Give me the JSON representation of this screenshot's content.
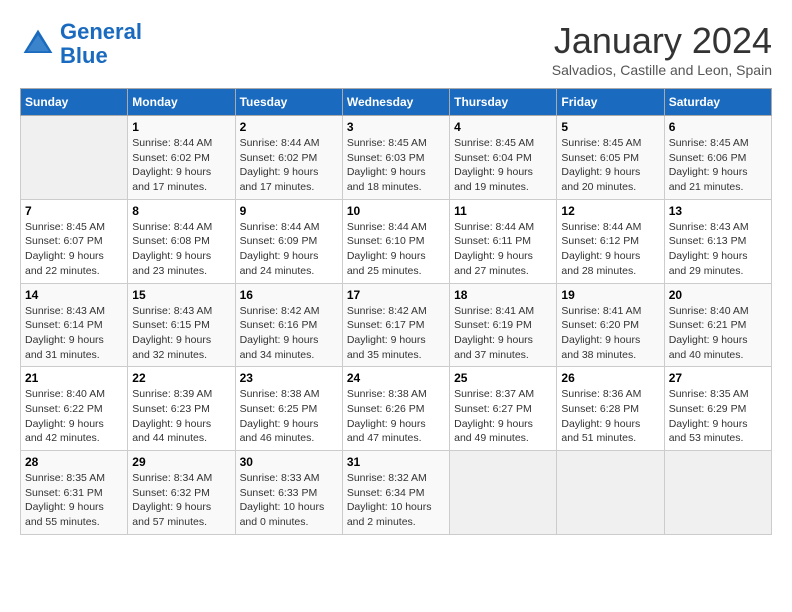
{
  "header": {
    "logo_line1": "General",
    "logo_line2": "Blue",
    "month_title": "January 2024",
    "subtitle": "Salvadios, Castille and Leon, Spain"
  },
  "weekdays": [
    "Sunday",
    "Monday",
    "Tuesday",
    "Wednesday",
    "Thursday",
    "Friday",
    "Saturday"
  ],
  "weeks": [
    [
      {
        "day": "",
        "empty": true
      },
      {
        "day": "1",
        "sunrise": "Sunrise: 8:44 AM",
        "sunset": "Sunset: 6:02 PM",
        "daylight": "Daylight: 9 hours and 17 minutes."
      },
      {
        "day": "2",
        "sunrise": "Sunrise: 8:44 AM",
        "sunset": "Sunset: 6:02 PM",
        "daylight": "Daylight: 9 hours and 17 minutes."
      },
      {
        "day": "3",
        "sunrise": "Sunrise: 8:45 AM",
        "sunset": "Sunset: 6:03 PM",
        "daylight": "Daylight: 9 hours and 18 minutes."
      },
      {
        "day": "4",
        "sunrise": "Sunrise: 8:45 AM",
        "sunset": "Sunset: 6:04 PM",
        "daylight": "Daylight: 9 hours and 19 minutes."
      },
      {
        "day": "5",
        "sunrise": "Sunrise: 8:45 AM",
        "sunset": "Sunset: 6:05 PM",
        "daylight": "Daylight: 9 hours and 20 minutes."
      },
      {
        "day": "6",
        "sunrise": "Sunrise: 8:45 AM",
        "sunset": "Sunset: 6:06 PM",
        "daylight": "Daylight: 9 hours and 21 minutes."
      }
    ],
    [
      {
        "day": "7",
        "sunrise": "Sunrise: 8:45 AM",
        "sunset": "Sunset: 6:07 PM",
        "daylight": "Daylight: 9 hours and 22 minutes."
      },
      {
        "day": "8",
        "sunrise": "Sunrise: 8:44 AM",
        "sunset": "Sunset: 6:08 PM",
        "daylight": "Daylight: 9 hours and 23 minutes."
      },
      {
        "day": "9",
        "sunrise": "Sunrise: 8:44 AM",
        "sunset": "Sunset: 6:09 PM",
        "daylight": "Daylight: 9 hours and 24 minutes."
      },
      {
        "day": "10",
        "sunrise": "Sunrise: 8:44 AM",
        "sunset": "Sunset: 6:10 PM",
        "daylight": "Daylight: 9 hours and 25 minutes."
      },
      {
        "day": "11",
        "sunrise": "Sunrise: 8:44 AM",
        "sunset": "Sunset: 6:11 PM",
        "daylight": "Daylight: 9 hours and 27 minutes."
      },
      {
        "day": "12",
        "sunrise": "Sunrise: 8:44 AM",
        "sunset": "Sunset: 6:12 PM",
        "daylight": "Daylight: 9 hours and 28 minutes."
      },
      {
        "day": "13",
        "sunrise": "Sunrise: 8:43 AM",
        "sunset": "Sunset: 6:13 PM",
        "daylight": "Daylight: 9 hours and 29 minutes."
      }
    ],
    [
      {
        "day": "14",
        "sunrise": "Sunrise: 8:43 AM",
        "sunset": "Sunset: 6:14 PM",
        "daylight": "Daylight: 9 hours and 31 minutes."
      },
      {
        "day": "15",
        "sunrise": "Sunrise: 8:43 AM",
        "sunset": "Sunset: 6:15 PM",
        "daylight": "Daylight: 9 hours and 32 minutes."
      },
      {
        "day": "16",
        "sunrise": "Sunrise: 8:42 AM",
        "sunset": "Sunset: 6:16 PM",
        "daylight": "Daylight: 9 hours and 34 minutes."
      },
      {
        "day": "17",
        "sunrise": "Sunrise: 8:42 AM",
        "sunset": "Sunset: 6:17 PM",
        "daylight": "Daylight: 9 hours and 35 minutes."
      },
      {
        "day": "18",
        "sunrise": "Sunrise: 8:41 AM",
        "sunset": "Sunset: 6:19 PM",
        "daylight": "Daylight: 9 hours and 37 minutes."
      },
      {
        "day": "19",
        "sunrise": "Sunrise: 8:41 AM",
        "sunset": "Sunset: 6:20 PM",
        "daylight": "Daylight: 9 hours and 38 minutes."
      },
      {
        "day": "20",
        "sunrise": "Sunrise: 8:40 AM",
        "sunset": "Sunset: 6:21 PM",
        "daylight": "Daylight: 9 hours and 40 minutes."
      }
    ],
    [
      {
        "day": "21",
        "sunrise": "Sunrise: 8:40 AM",
        "sunset": "Sunset: 6:22 PM",
        "daylight": "Daylight: 9 hours and 42 minutes."
      },
      {
        "day": "22",
        "sunrise": "Sunrise: 8:39 AM",
        "sunset": "Sunset: 6:23 PM",
        "daylight": "Daylight: 9 hours and 44 minutes."
      },
      {
        "day": "23",
        "sunrise": "Sunrise: 8:38 AM",
        "sunset": "Sunset: 6:25 PM",
        "daylight": "Daylight: 9 hours and 46 minutes."
      },
      {
        "day": "24",
        "sunrise": "Sunrise: 8:38 AM",
        "sunset": "Sunset: 6:26 PM",
        "daylight": "Daylight: 9 hours and 47 minutes."
      },
      {
        "day": "25",
        "sunrise": "Sunrise: 8:37 AM",
        "sunset": "Sunset: 6:27 PM",
        "daylight": "Daylight: 9 hours and 49 minutes."
      },
      {
        "day": "26",
        "sunrise": "Sunrise: 8:36 AM",
        "sunset": "Sunset: 6:28 PM",
        "daylight": "Daylight: 9 hours and 51 minutes."
      },
      {
        "day": "27",
        "sunrise": "Sunrise: 8:35 AM",
        "sunset": "Sunset: 6:29 PM",
        "daylight": "Daylight: 9 hours and 53 minutes."
      }
    ],
    [
      {
        "day": "28",
        "sunrise": "Sunrise: 8:35 AM",
        "sunset": "Sunset: 6:31 PM",
        "daylight": "Daylight: 9 hours and 55 minutes."
      },
      {
        "day": "29",
        "sunrise": "Sunrise: 8:34 AM",
        "sunset": "Sunset: 6:32 PM",
        "daylight": "Daylight: 9 hours and 57 minutes."
      },
      {
        "day": "30",
        "sunrise": "Sunrise: 8:33 AM",
        "sunset": "Sunset: 6:33 PM",
        "daylight": "Daylight: 10 hours and 0 minutes."
      },
      {
        "day": "31",
        "sunrise": "Sunrise: 8:32 AM",
        "sunset": "Sunset: 6:34 PM",
        "daylight": "Daylight: 10 hours and 2 minutes."
      },
      {
        "day": "",
        "empty": true
      },
      {
        "day": "",
        "empty": true
      },
      {
        "day": "",
        "empty": true
      }
    ]
  ]
}
